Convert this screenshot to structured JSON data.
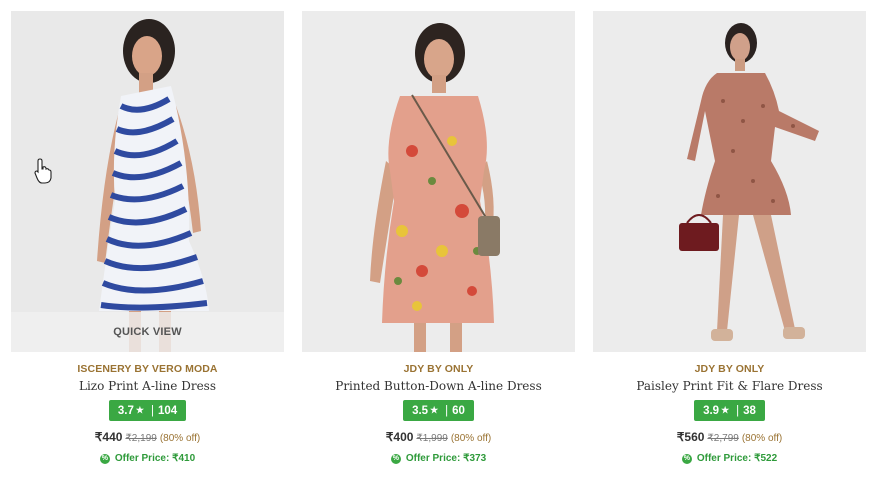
{
  "products": [
    {
      "brand": "ISCENERY BY VERO MODA",
      "name": "Lizo Print A-line Dress",
      "rating": "3.7",
      "reviews": "104",
      "price": "₹440",
      "mrp": "₹2,199",
      "discount": "(80% off)",
      "offer_label": "Offer Price: ₹410",
      "quick_view": "QUICK VIEW",
      "dress_color": "#2f4aa0"
    },
    {
      "brand": "JDY BY ONLY",
      "name": "Printed Button-Down A-line Dress",
      "rating": "3.5",
      "reviews": "60",
      "price": "₹400",
      "mrp": "₹1,999",
      "discount": "(80% off)",
      "offer_label": "Offer Price: ₹373",
      "dress_color": "#e3a08c"
    },
    {
      "brand": "JDY BY ONLY",
      "name": "Paisley Print Fit & Flare Dress",
      "rating": "3.9",
      "reviews": "38",
      "price": "₹560",
      "mrp": "₹2,799",
      "discount": "(80% off)",
      "offer_label": "Offer Price: ₹522",
      "dress_color": "#b97a68"
    }
  ],
  "icons": {
    "star": "star-icon",
    "offer": "offer-percent-icon",
    "cursor": "hand-cursor-icon"
  },
  "colors": {
    "rating_bg": "#3aa843",
    "brand_text": "#9a7333",
    "offer_text": "#2e9a3a"
  }
}
